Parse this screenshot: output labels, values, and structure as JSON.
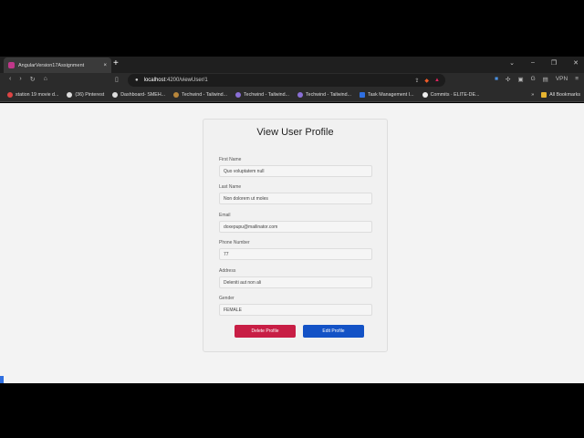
{
  "browser": {
    "tab_title": "AngularVersion17Assignment",
    "url_host": "localhost",
    "url_path": ":4200/viewUser/1",
    "vpn": "VPN"
  },
  "bookmarks": [
    "station 19 movie d...",
    "(36) Pinterest",
    "Dashboard- SMEH...",
    "Techwind - Tailwind...",
    "Techwind - Tailwind...",
    "Techwind - Tailwind...",
    "Task Management I...",
    "Commits · ELITE-DE..."
  ],
  "all_bookmarks": "All Bookmarks",
  "profile": {
    "title": "View User Profile",
    "fields": [
      {
        "label": "First Name",
        "value": "Quo voluptatem null"
      },
      {
        "label": "Last Name",
        "value": "Non dolorem ut moles"
      },
      {
        "label": "Email",
        "value": "doxepupu@mailinator.com"
      },
      {
        "label": "Phone Number",
        "value": "77"
      },
      {
        "label": "Address",
        "value": "Deleniti aut non ali"
      },
      {
        "label": "Gender",
        "value": "FEMALE"
      }
    ],
    "delete_label": "Delete Profile",
    "edit_label": "Edit Profile",
    "colors": {
      "delete": "#c81e45",
      "edit": "#1352c6"
    }
  }
}
